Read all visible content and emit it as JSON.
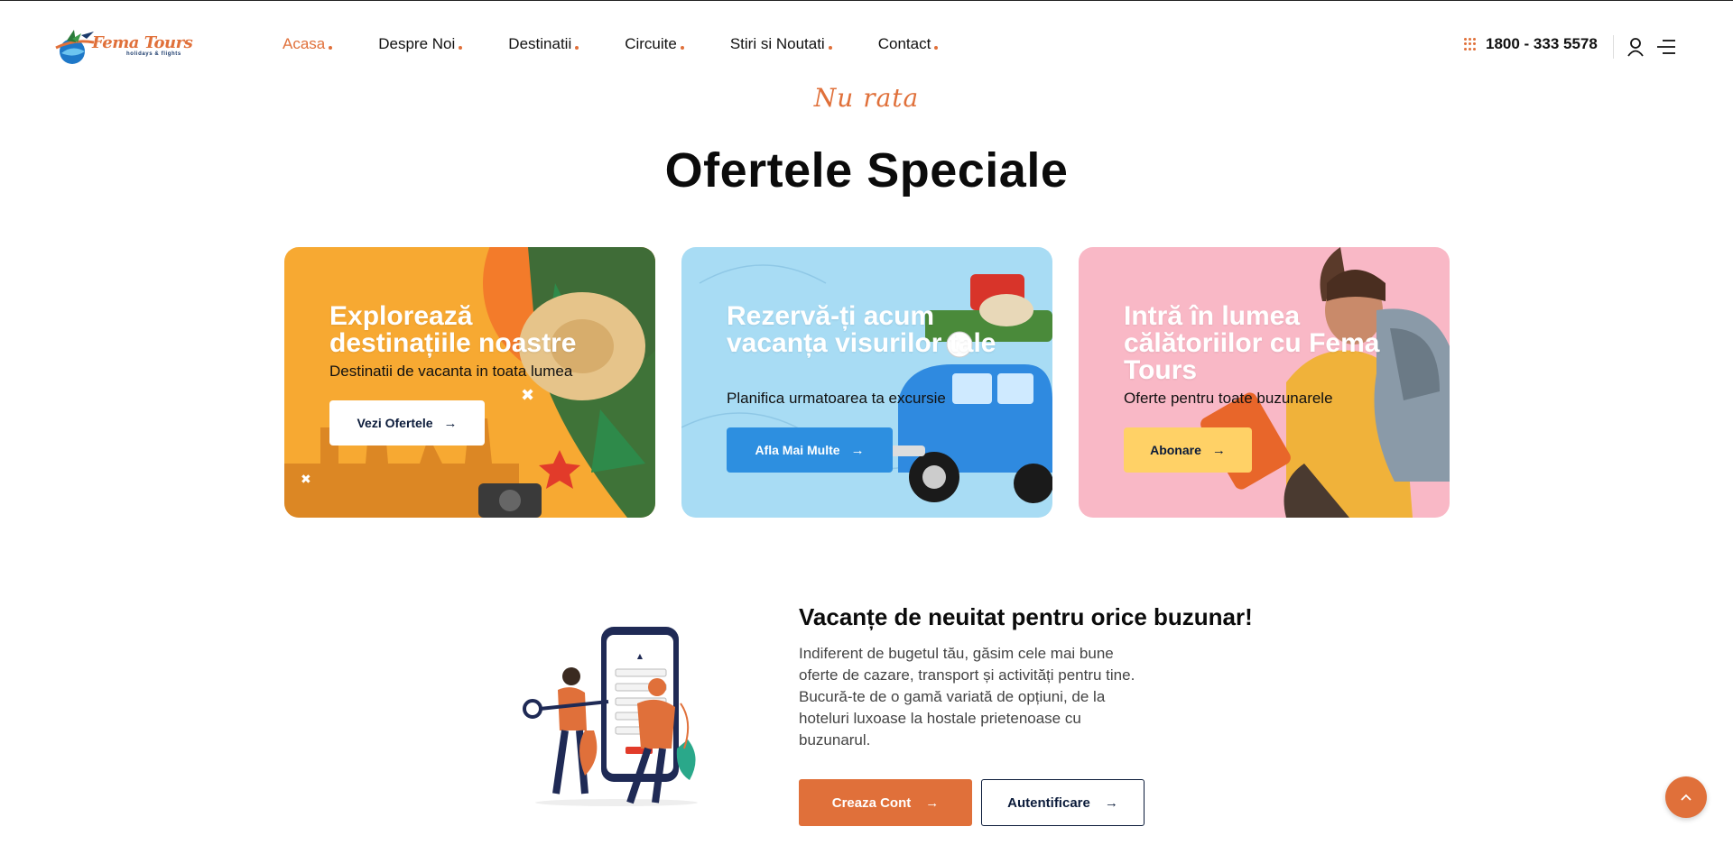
{
  "brand": {
    "name": "Fema Tours",
    "tagline": "holidays & flights",
    "accent_color": "#e0703a"
  },
  "nav": {
    "items": [
      {
        "label": "Acasa",
        "active": true
      },
      {
        "label": "Despre Noi",
        "active": false
      },
      {
        "label": "Destinatii",
        "active": false
      },
      {
        "label": "Circuite",
        "active": false
      },
      {
        "label": "Stiri si Noutati",
        "active": false
      },
      {
        "label": "Contact",
        "active": false
      }
    ]
  },
  "header": {
    "phone": "1800 - 333 5578",
    "icons": [
      "dots-grid-icon",
      "user-icon",
      "menu-icon"
    ]
  },
  "offers": {
    "script_title": "Nu rata",
    "title": "Ofertele Speciale",
    "cards": [
      {
        "title": "Explorează destinațiile noastre",
        "subtitle": "Destinatii de vacanta in toata lumea",
        "button": "Vezi Ofertele",
        "button_color": "#ffffff"
      },
      {
        "title": "Rezervă-ți acum vacanța visurilor tale",
        "subtitle": "Planifica urmatoarea ta excursie",
        "button": "Afla Mai Multe",
        "button_color": "#2d8fe0"
      },
      {
        "title": "Intră în lumea călătoriilor cu Fema Tours",
        "subtitle": "Oferte pentru toate buzunarele",
        "button": "Abonare",
        "button_color": "#ffd166"
      }
    ]
  },
  "account": {
    "title": "Vacanțe de neuitat pentru orice buzunar!",
    "body": "Indiferent de bugetul tău, găsim cele mai bune oferte de cazare, transport și activități pentru tine. Bucură-te de o gamă variată de opțiuni, de la hoteluri luxoase la hostale prietenoase cu buzunarul.",
    "create_button": "Creaza Cont",
    "login_button": "Autentificare"
  },
  "scroll_top": {
    "icon": "chevron-up-icon"
  }
}
